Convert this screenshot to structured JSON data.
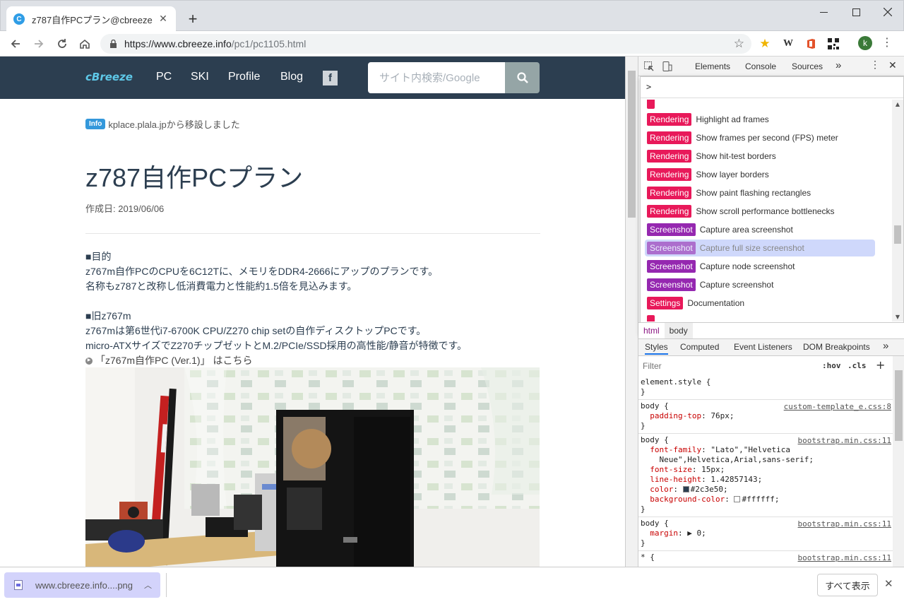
{
  "browser": {
    "tab_title": "z787自作PCプラン@cbreeze",
    "tab_favicon_letter": "C",
    "url_host": "https://www.cbreeze.info",
    "url_path": "/pc1/pc1105.html",
    "ext_w_label": "W",
    "avatar_letter": "k"
  },
  "site": {
    "brand": "cBreeze",
    "nav": [
      "PC",
      "SKI",
      "Profile",
      "Blog"
    ],
    "fb_letter": "f",
    "search_placeholder": "サイト内検索/Google",
    "info_badge": "Info",
    "info_text": "kplace.plala.jpから移設しました",
    "title": "z787自作PCプラン",
    "date": "作成日: 2019/06/06",
    "paragraphs": [
      "■目的",
      "z767m自作PCのCPUを6C12Tに、メモリをDDR4-2666にアップのプランです。",
      "名称もz787と改称し低消費電力と性能約1.5倍を見込みます。",
      "",
      "■旧z767m",
      "z767mは第6世代i7-6700K CPU/Z270 chip setの自作ディスクトップPCです。",
      "micro-ATXサイズでZ270チップゼットとM.2/PCIe/SSD採用の高性能/静音が特徴です。"
    ],
    "link_text": "「z767m自作PC (Ver.1)」 はこちら"
  },
  "devtools": {
    "tabs": [
      "Elements",
      "Console",
      "Sources"
    ],
    "command_prompt": ">",
    "commands": [
      {
        "tag": "Rendering",
        "tag_type": "r",
        "label": "Highlight ad frames"
      },
      {
        "tag": "Rendering",
        "tag_type": "r",
        "label": "Show frames per second (FPS) meter"
      },
      {
        "tag": "Rendering",
        "tag_type": "r",
        "label": "Show hit-test borders"
      },
      {
        "tag": "Rendering",
        "tag_type": "r",
        "label": "Show layer borders"
      },
      {
        "tag": "Rendering",
        "tag_type": "r",
        "label": "Show paint flashing rectangles"
      },
      {
        "tag": "Rendering",
        "tag_type": "r",
        "label": "Show scroll performance bottlenecks"
      },
      {
        "tag": "Screenshot",
        "tag_type": "s",
        "label": "Capture area screenshot"
      },
      {
        "tag": "Screenshot",
        "tag_type": "s",
        "label": "Capture full size screenshot",
        "selected": true
      },
      {
        "tag": "Screenshot",
        "tag_type": "s",
        "label": "Capture node screenshot"
      },
      {
        "tag": "Screenshot",
        "tag_type": "s",
        "label": "Capture screenshot"
      },
      {
        "tag": "Settings",
        "tag_type": "st",
        "label": "Documentation"
      }
    ],
    "crumbs": [
      "html",
      "body"
    ],
    "subtabs": [
      "Styles",
      "Computed",
      "Event Listeners",
      "DOM Breakpoints"
    ],
    "filter_placeholder": "Filter",
    "hov_label": ":hov",
    "cls_label": ".cls",
    "rules": {
      "r0_selector": "element.style {",
      "r0_close": "}",
      "r1_selector": "body {",
      "r1_src": "custom-template_e.css:8",
      "r1_p1_name": "padding-top",
      "r1_p1_value": ": 76px;",
      "r1_close": "}",
      "r2_selector": "body {",
      "r2_src": "bootstrap.min.css:11",
      "r2_p1_name": "font-family",
      "r2_p1_value": ": \"Lato\",\"Helvetica",
      "r2_p1_cont": "    Neue\",Helvetica,Arial,sans-serif;",
      "r2_p2_name": "font-size",
      "r2_p2_value": ": 15px;",
      "r2_p3_name": "line-height",
      "r2_p3_value": ": 1.42857143;",
      "r2_p4_name": "color",
      "r2_p4_value": "#2c3e50;",
      "r2_p5_name": "background-color",
      "r2_p5_value": "#ffffff;",
      "r2_close": "}",
      "r3_selector": "body {",
      "r3_src": "bootstrap.min.css:11",
      "r3_p1_name": "margin",
      "r3_p1_value": "0;",
      "r3_close": "}",
      "r4_selector": "* {",
      "r4_src": "bootstrap.min.css:11"
    }
  },
  "downloads": {
    "file_name": "www.cbreeze.info....png",
    "show_all": "すべて表示"
  }
}
